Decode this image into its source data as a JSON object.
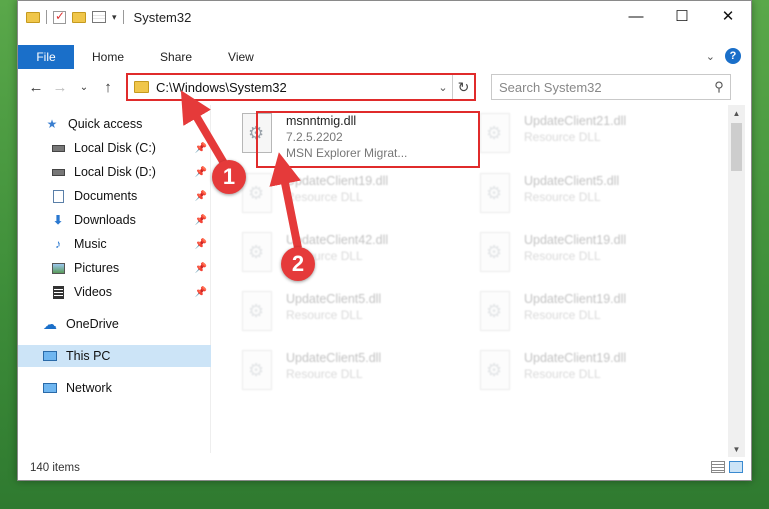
{
  "window": {
    "title": "System32",
    "controls": [
      "minimize",
      "maximize",
      "close"
    ]
  },
  "ribbon": {
    "tabs": [
      "File",
      "Home",
      "Share",
      "View"
    ]
  },
  "address_bar": {
    "path": "C:\\Windows\\System32",
    "search_placeholder": "Search System32"
  },
  "sidebar": {
    "items": [
      {
        "label": "Quick access",
        "icon": "star-icon"
      },
      {
        "label": "Local Disk (C:)",
        "icon": "drive-icon",
        "pinned": true
      },
      {
        "label": "Local Disk (D:)",
        "icon": "drive-icon",
        "pinned": true
      },
      {
        "label": "Documents",
        "icon": "documents-icon",
        "pinned": true
      },
      {
        "label": "Downloads",
        "icon": "download-icon",
        "pinned": true
      },
      {
        "label": "Music",
        "icon": "music-icon",
        "pinned": true
      },
      {
        "label": "Pictures",
        "icon": "pictures-icon",
        "pinned": true
      },
      {
        "label": "Videos",
        "icon": "videos-icon",
        "pinned": true
      },
      {
        "label": "OneDrive",
        "icon": "cloud-icon"
      },
      {
        "label": "This PC",
        "icon": "computer-icon",
        "selected": true
      },
      {
        "label": "Network",
        "icon": "network-icon"
      }
    ]
  },
  "files": {
    "highlighted": {
      "name": "msnntmig.dll",
      "version": "7.2.5.2202",
      "description": "MSN Explorer Migrat..."
    },
    "col1": [
      {
        "name": "UpdateClient19.dll",
        "type": "Resource DLL"
      },
      {
        "name": "UpdateClient42.dll",
        "type": "Resource DLL"
      },
      {
        "name": "UpdateClient5.dll",
        "type": "Resource DLL"
      },
      {
        "name": "UpdateClient5.dll",
        "type": "Resource DLL"
      }
    ],
    "col2": [
      {
        "name": "UpdateClient21.dll",
        "type": "Resource DLL"
      },
      {
        "name": "UpdateClient5.dll",
        "type": "Resource DLL"
      },
      {
        "name": "UpdateClient19.dll",
        "type": "Resource DLL"
      },
      {
        "name": "UpdateClient19.dll",
        "type": "Resource DLL"
      },
      {
        "name": "UpdateClient19.dll",
        "type": "Resource DLL"
      }
    ]
  },
  "status": {
    "item_count": "140 items"
  },
  "annotations": {
    "step1": "1",
    "step2": "2",
    "color": "#e53a3a"
  }
}
